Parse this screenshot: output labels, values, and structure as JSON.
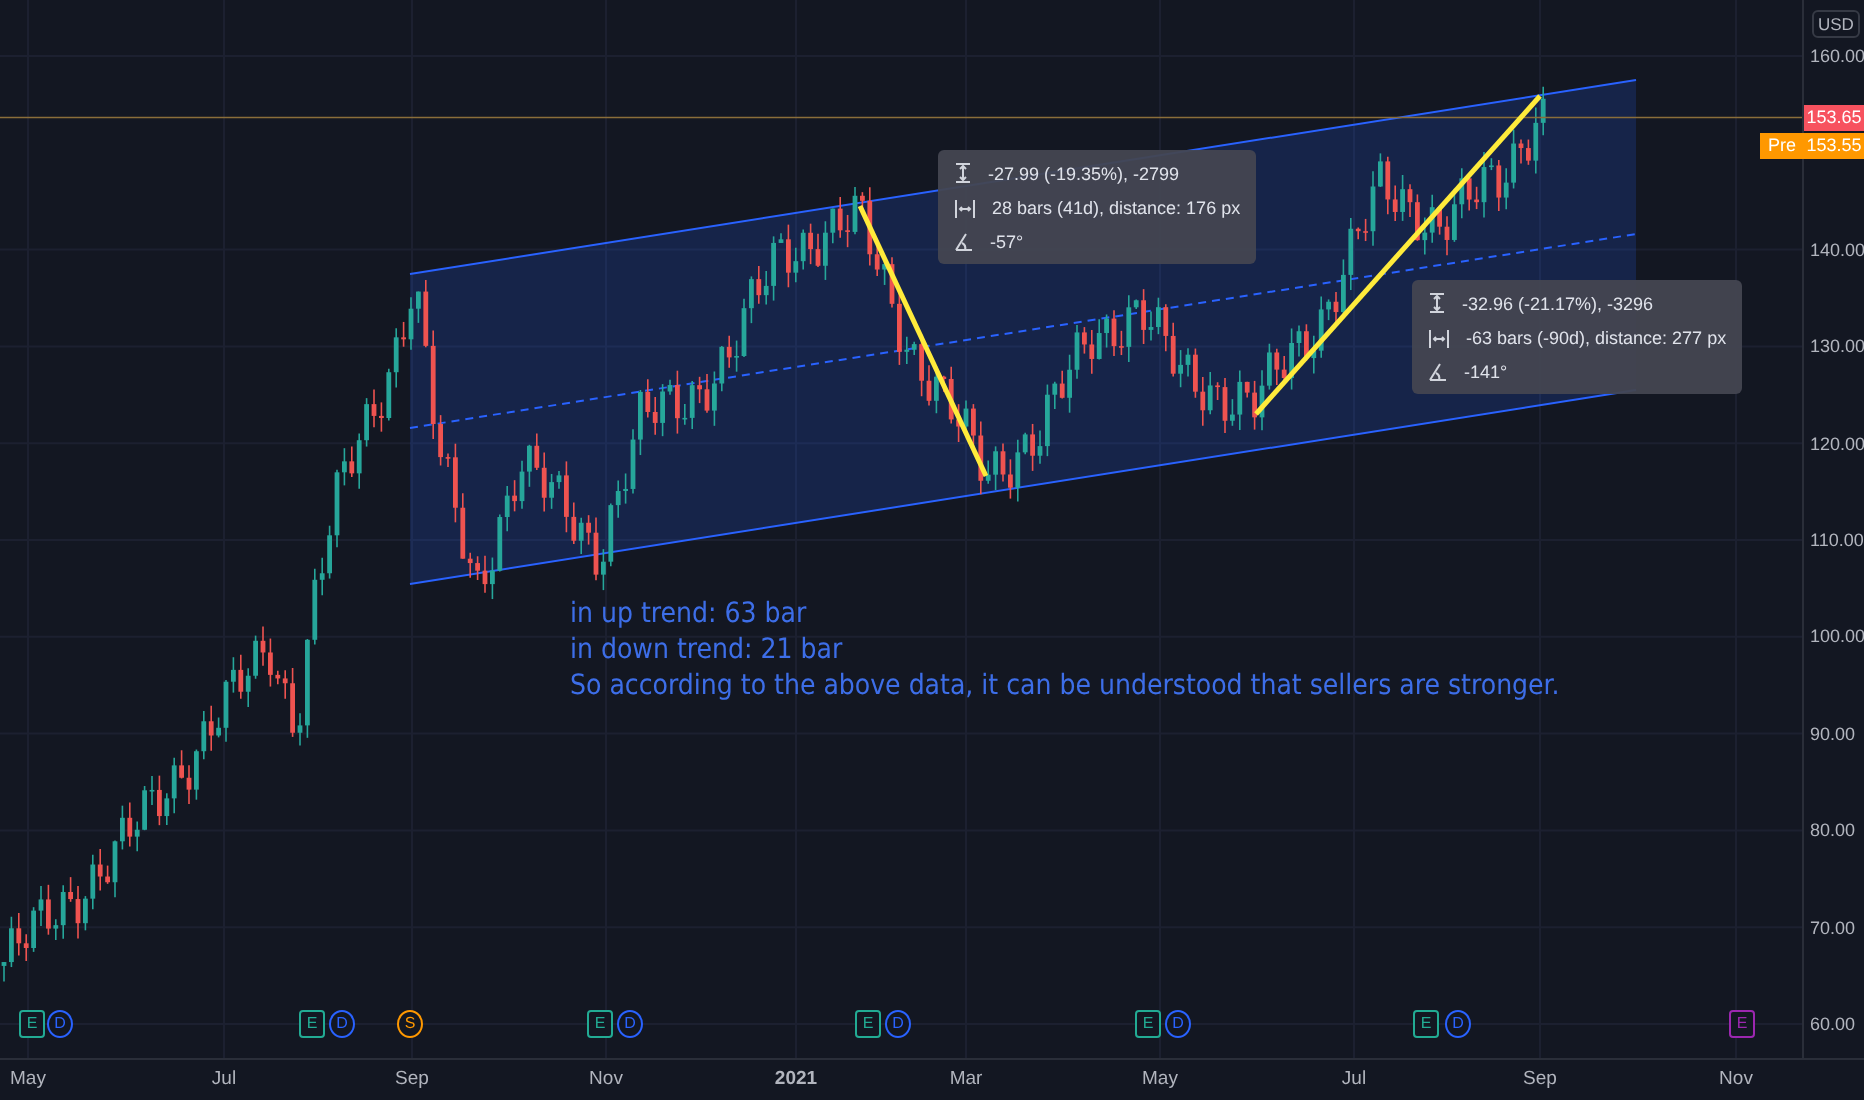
{
  "price_axis": {
    "currency": "USD",
    "ticks": [
      "160.00",
      "140.00",
      "130.00",
      "120.00",
      "110.00",
      "100.00",
      "90.00",
      "80.00",
      "70.00",
      "60.00"
    ],
    "last_price": "153.65",
    "premarket": {
      "label": "Pre",
      "price": "153.55"
    }
  },
  "time_axis": {
    "labels": [
      {
        "text": "May",
        "bold": false
      },
      {
        "text": "Jul",
        "bold": false
      },
      {
        "text": "Sep",
        "bold": false
      },
      {
        "text": "Nov",
        "bold": false
      },
      {
        "text": "2021",
        "bold": true
      },
      {
        "text": "Mar",
        "bold": false
      },
      {
        "text": "May",
        "bold": false
      },
      {
        "text": "Jul",
        "bold": false
      },
      {
        "text": "Sep",
        "bold": false
      },
      {
        "text": "Nov",
        "bold": false
      }
    ]
  },
  "events": [
    {
      "kind": "earnings",
      "label": "E"
    },
    {
      "kind": "dividend",
      "label": "D"
    },
    {
      "kind": "earnings",
      "label": "E"
    },
    {
      "kind": "dividend",
      "label": "D"
    },
    {
      "kind": "split",
      "label": "S"
    },
    {
      "kind": "earnings",
      "label": "E"
    },
    {
      "kind": "dividend",
      "label": "D"
    },
    {
      "kind": "earnings",
      "label": "E"
    },
    {
      "kind": "dividend",
      "label": "D"
    },
    {
      "kind": "earnings",
      "label": "E"
    },
    {
      "kind": "dividend",
      "label": "D"
    },
    {
      "kind": "earnings",
      "label": "E"
    },
    {
      "kind": "dividend",
      "label": "D"
    },
    {
      "kind": "upcoming",
      "label": "E"
    }
  ],
  "measurements": [
    {
      "price_change": "-27.99 (-19.35%), -2799",
      "bars": "28 bars (41d), distance: 176 px",
      "angle": "-57°"
    },
    {
      "price_change": "-32.96 (-21.17%), -3296",
      "bars": "-63 bars (-90d), distance: 277 px",
      "angle": "-141°"
    }
  ],
  "note": {
    "lines": [
      "in up trend: 63 bar",
      "in down trend: 21 bar",
      "So according to the above data, it can be understood that sellers are stronger."
    ]
  }
}
